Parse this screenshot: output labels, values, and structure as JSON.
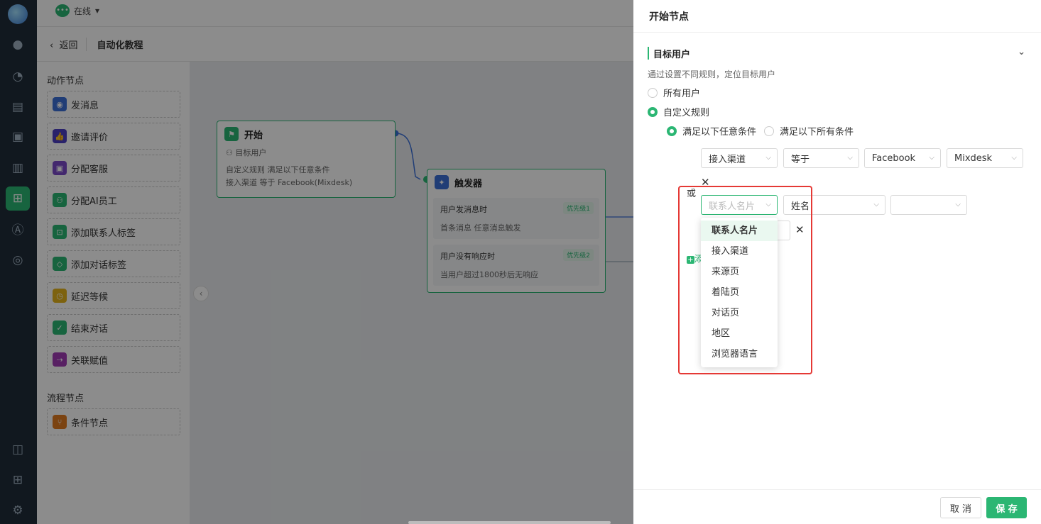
{
  "colors": {
    "accent": "#2bb673",
    "rail": "#1f2d3a",
    "highlight": "#e53935"
  },
  "status": {
    "label": "在线",
    "icon": "chat-bubble-icon"
  },
  "breadcrumb": {
    "back": "返回",
    "title": "自动化教程"
  },
  "palette": {
    "action_title": "动作节点",
    "actions": [
      {
        "label": "发消息",
        "icon": "message-icon",
        "color": "#3b6fd8"
      },
      {
        "label": "邀请评价",
        "icon": "thumbs-up-icon",
        "color": "#4b3fc4"
      },
      {
        "label": "分配客服",
        "icon": "agent-icon",
        "color": "#7a49c9"
      },
      {
        "label": "分配AI员工",
        "icon": "ai-agent-icon",
        "color": "#2bb673"
      },
      {
        "label": "添加联系人标签",
        "icon": "contact-tag-icon",
        "color": "#2bb673"
      },
      {
        "label": "添加对话标签",
        "icon": "conversation-tag-icon",
        "color": "#2bb673"
      },
      {
        "label": "延迟等候",
        "icon": "clock-icon",
        "color": "#e3b21b"
      },
      {
        "label": "结束对话",
        "icon": "check-icon",
        "color": "#2bb673"
      },
      {
        "label": "关联赋值",
        "icon": "link-icon",
        "color": "#a13bb5"
      }
    ],
    "flow_title": "流程节点",
    "flows": [
      {
        "label": "条件节点",
        "icon": "branch-icon",
        "color": "#e07a1f"
      }
    ]
  },
  "canvas": {
    "start_node": {
      "title": "开始",
      "target": "目标用户",
      "rule_line1": "自定义规则  满足以下任意条件",
      "rule_line2": "接入渠道  等于  Facebook(Mixdesk)"
    },
    "trigger_node": {
      "title": "触发器",
      "triggers": [
        {
          "title": "用户发消息时",
          "detail": "首条消息  任意消息触发",
          "priority": "优先级1"
        },
        {
          "title": "用户没有响应时",
          "detail": "当用户超过1800秒后无响应",
          "priority": "优先级2"
        }
      ]
    }
  },
  "drawer": {
    "title": "开始节点",
    "section_title": "目标用户",
    "hint": "通过设置不同规则，定位目标用户",
    "radio_all": "所有用户",
    "radio_custom": "自定义规则",
    "match_any": "满足以下任意条件",
    "match_all": "满足以下所有条件",
    "rule1": {
      "field": "接入渠道",
      "operator": "等于",
      "value1": "Facebook",
      "value2": "Mixdesk"
    },
    "or_label": "或",
    "rule2": {
      "field_placeholder": "联系人名片",
      "attribute": "姓名",
      "value": ""
    },
    "add_label": "添",
    "dropdown_options": [
      "联系人名片",
      "接入渠道",
      "来源页",
      "着陆页",
      "对话页",
      "地区",
      "浏览器语言"
    ],
    "cancel": "取 消",
    "save": "保 存"
  }
}
